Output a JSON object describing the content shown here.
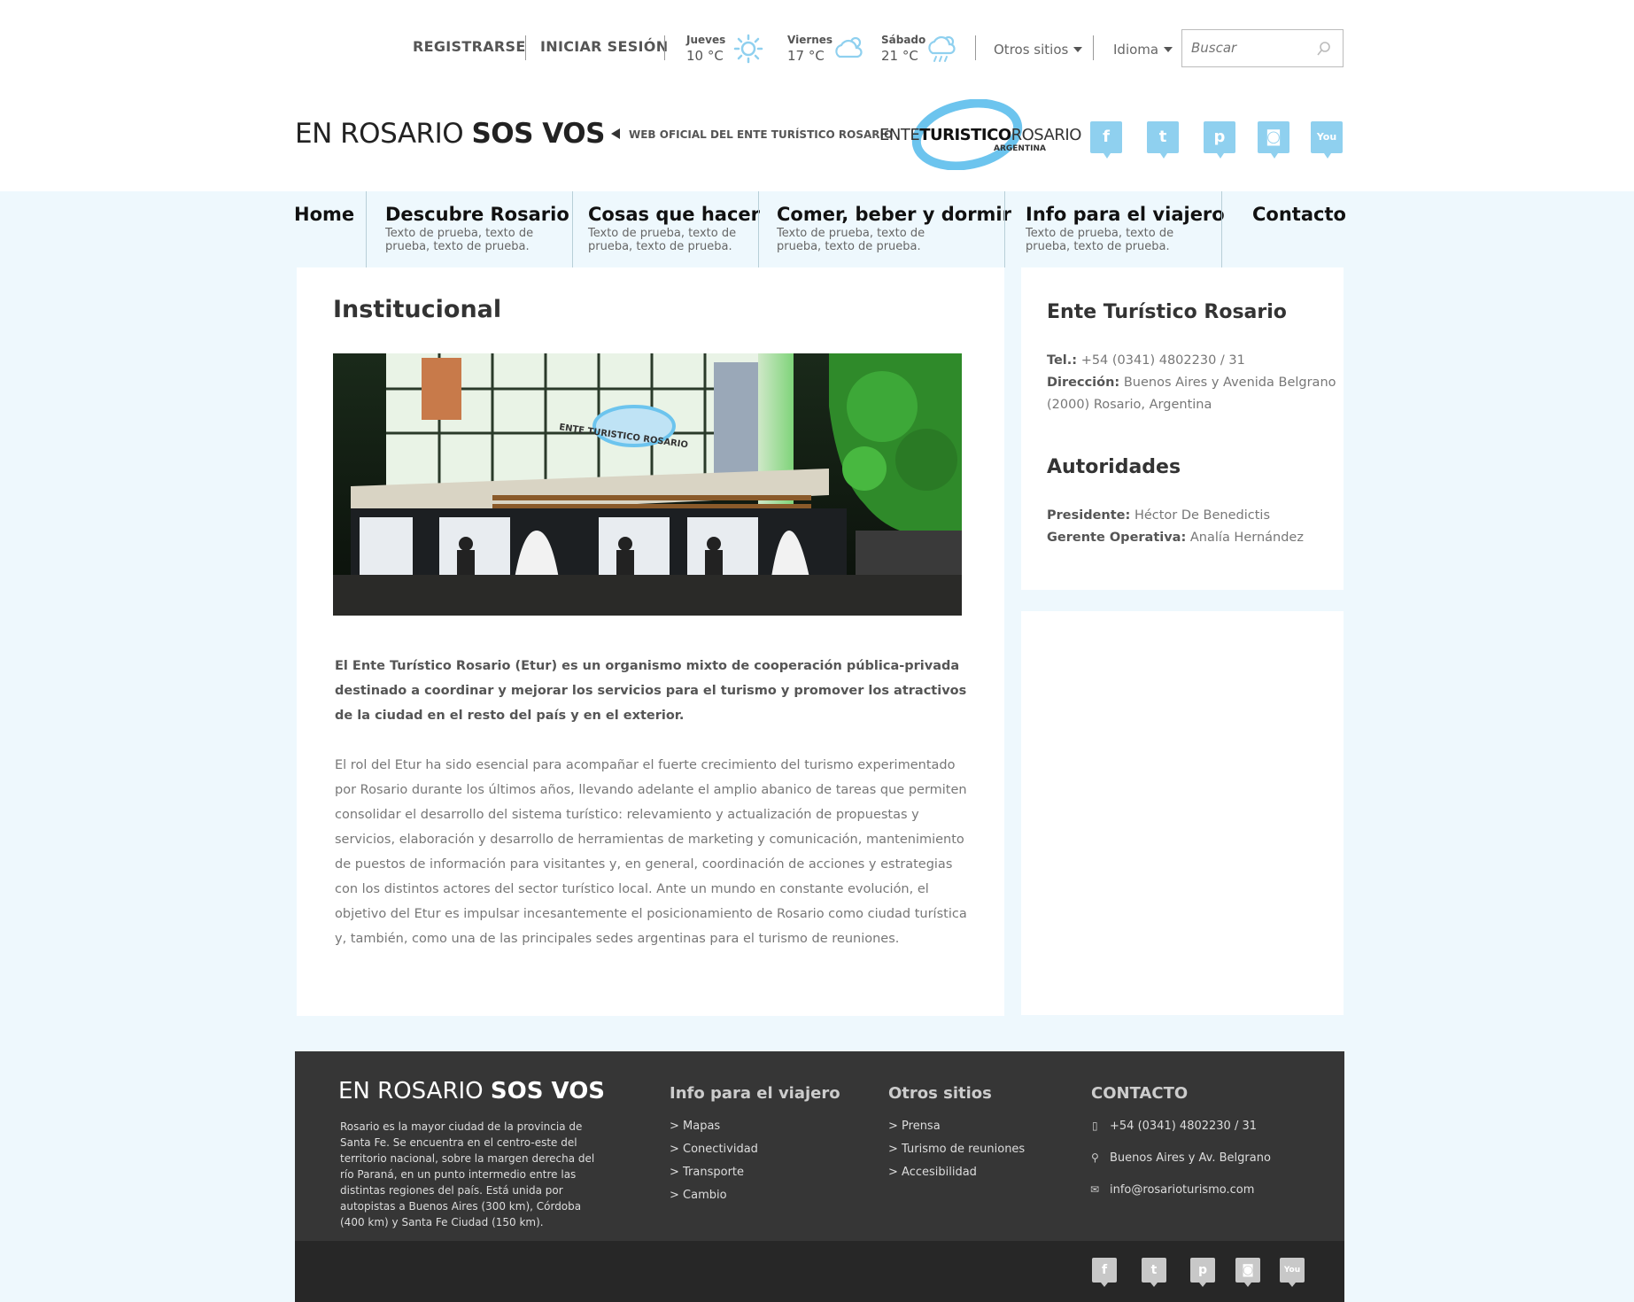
{
  "topbar": {
    "register": "REGISTRARSE",
    "login": "INICIAR SESIÓN",
    "weather": [
      {
        "day": "Jueves",
        "temp": "10 °C",
        "icon": "sun-icon"
      },
      {
        "day": "Viernes",
        "temp": "17 °C",
        "icon": "cloud-sun-icon"
      },
      {
        "day": "Sábado",
        "temp": "21 °C",
        "icon": "cloud-rain-icon"
      }
    ],
    "other_sites": "Otros sitios",
    "language": "Idioma",
    "search_placeholder": "Buscar"
  },
  "header": {
    "brand_light": "EN ROSARIO ",
    "brand_bold": "SOS VOS",
    "tagline": "WEB OFICIAL DEL ENTE TURÍSTICO ROSARIO",
    "logo": {
      "ente": "ENTE",
      "turistico": "TURISTICO",
      "rosario": "ROSARIO",
      "country": "ARGENTINA"
    },
    "social": [
      "facebook-icon",
      "twitter-icon",
      "pinterest-icon",
      "instagram-icon",
      "youtube-icon"
    ]
  },
  "nav": [
    {
      "title": "Home",
      "sub": ""
    },
    {
      "title": "Descubre Rosario",
      "sub": "Texto de prueba, texto de prueba, texto de prueba."
    },
    {
      "title": "Cosas que hacer",
      "sub": "Texto de prueba, texto de prueba, texto de prueba."
    },
    {
      "title": "Comer, beber y dormir",
      "sub": "Texto de prueba, texto de prueba, texto de prueba."
    },
    {
      "title": "Info para el viajero",
      "sub": "Texto de prueba, texto de prueba, texto de prueba."
    },
    {
      "title": "Contacto",
      "sub": ""
    }
  ],
  "main": {
    "title": "Institucional",
    "lead": "El Ente Turístico Rosario (Etur) es un organismo mixto de cooperación pública-privada destinado a coordinar y mejorar los servicios para el turismo y promover los atractivos de la ciudad en el resto del país y en el exterior.",
    "body": "El rol del Etur ha sido esencial para acompañar el fuerte crecimiento del turismo experimentado por Rosario durante los últimos años, llevando adelante el amplio abanico de tareas que permiten consolidar el desarrollo del sistema turístico: relevamiento y actualización de propuestas y servicios, elaboración y desarrollo de herramientas de marketing y comunicación, mantenimiento de puestos de información para visitantes y, en general, coordinación de acciones y estrategias con los distintos actores del sector turístico local. Ante un mundo en constante evolución, el objetivo del Etur es impulsar incesantemente el posicionamiento de Rosario como ciudad turística y, también, como una de las principales sedes argentinas para el turismo de reuniones.",
    "photo_sign": "ENTE TURISTICO ROSARIO"
  },
  "sidebar": {
    "org_title": "Ente Turístico Rosario",
    "tel_label": "Tel.:",
    "tel": "+54 (0341) 4802230 / 31",
    "address_label": "Dirección:",
    "address": "Buenos Aires y Avenida Belgrano",
    "address2": "(2000) Rosario, Argentina",
    "authorities_title": "Autoridades",
    "president_label": "Presidente:",
    "president": "Héctor De Benedictis",
    "manager_label": "Gerente Operativa:",
    "manager": "Analía Hernández"
  },
  "footer": {
    "brand_light": "EN ROSARIO ",
    "brand_bold": "SOS VOS",
    "description": "Rosario es la mayor ciudad de la provincia de Santa Fe. Se encuentra en el centro-este del territorio nacional, sobre la margen derecha del río Paraná, en un punto intermedio entre las distintas regiones del país. Está unida por autopistas a Buenos Aires (300 km), Córdoba (400 km) y Santa Fe Ciudad (150 km).",
    "col_info": {
      "title": "Info para el viajero",
      "links": [
        "> Mapas",
        "> Conectividad",
        "> Transporte",
        "> Cambio"
      ]
    },
    "col_other": {
      "title": "Otros sitios",
      "links": [
        "> Prensa",
        "> Turismo de reuniones",
        "> Accesibilidad"
      ]
    },
    "contact": {
      "title": "CONTACTO",
      "phone": "+54 (0341) 4802230 / 31",
      "address": "Buenos Aires y Av. Belgrano",
      "email": "info@rosarioturismo.com"
    }
  },
  "colors": {
    "accent": "#8fd0ef",
    "page_bg": "#eef8fd",
    "footer_bg": "#363636",
    "footer_bottom": "#272727"
  }
}
